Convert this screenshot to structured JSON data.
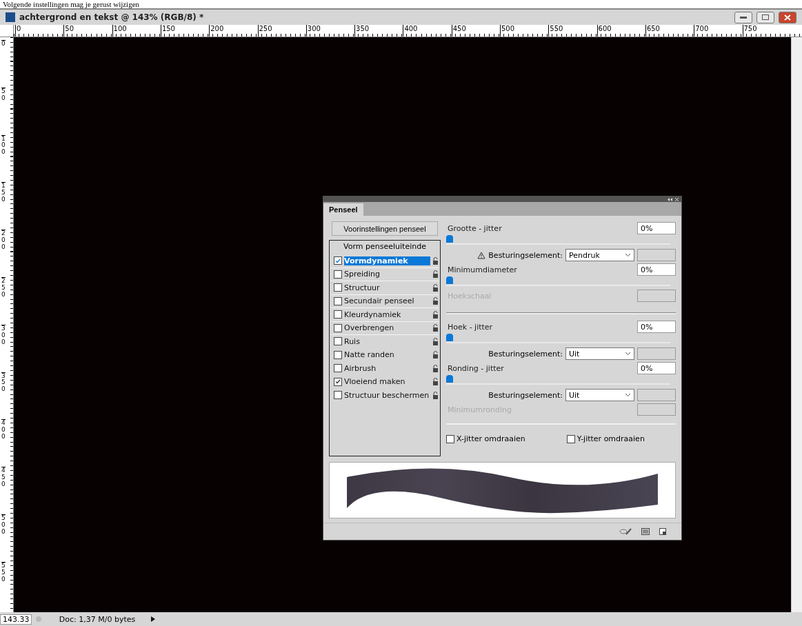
{
  "caption": "Volgende instellingen mag je gerust wijzigen",
  "window": {
    "title": "achtergrond en tekst @ 143% (RGB/8) *"
  },
  "ruler_h": [
    "0",
    "50",
    "100",
    "150",
    "200",
    "250",
    "300",
    "350",
    "400",
    "450",
    "500",
    "550",
    "600",
    "650",
    "700",
    "750"
  ],
  "ruler_v": [
    "0",
    "50",
    "100",
    "150",
    "200",
    "250",
    "300",
    "350",
    "400",
    "450",
    "500",
    "550"
  ],
  "panel": {
    "tab": {
      "label": "Penseel",
      "selected": true
    },
    "preset_button": "Voorinstellingen penseel",
    "options_header": "Vorm penseeluiteinde",
    "options": [
      {
        "label": "Vormdynamiek",
        "checked": true,
        "selected": true
      },
      {
        "label": "Spreiding",
        "checked": false,
        "selected": false
      },
      {
        "label": "Structuur",
        "checked": false,
        "selected": false
      },
      {
        "label": "Secundair penseel",
        "checked": false,
        "selected": false
      },
      {
        "label": "Kleurdynamiek",
        "checked": false,
        "selected": false
      },
      {
        "label": "Overbrengen",
        "checked": false,
        "selected": false
      },
      {
        "label": "Ruis",
        "checked": false,
        "selected": false
      },
      {
        "label": "Natte randen",
        "checked": false,
        "selected": false
      },
      {
        "label": "Airbrush",
        "checked": false,
        "selected": false
      },
      {
        "label": "Vloeiend maken",
        "checked": true,
        "selected": false
      },
      {
        "label": "Structuur beschermen",
        "checked": false,
        "selected": false
      }
    ],
    "settings": [
      {
        "kind": "slider",
        "label": "Grootte - jitter",
        "value": "0%",
        "level": 0
      },
      {
        "kind": "control",
        "label": "Besturingselement:",
        "value": "Pendruk",
        "warning": true
      },
      {
        "kind": "slider",
        "label": "Minimumdiameter",
        "value": "0%",
        "level": 0
      },
      {
        "kind": "disabled",
        "label": "Hoekschaal"
      },
      {
        "kind": "divider"
      },
      {
        "kind": "slider",
        "label": "Hoek - jitter",
        "value": "0%",
        "level": 0
      },
      {
        "kind": "control",
        "label": "Besturingselement:",
        "value": "Uit",
        "warning": false
      },
      {
        "kind": "slider",
        "label": "Ronding - jitter",
        "value": "0%",
        "level": 0
      },
      {
        "kind": "control",
        "label": "Besturingselement:",
        "value": "Uit",
        "warning": false
      },
      {
        "kind": "disabled",
        "label": "Minimumronding"
      }
    ],
    "flips": [
      {
        "label": "X-jitter omdraaien",
        "checked": false
      },
      {
        "label": "Y-jitter omdraaien",
        "checked": false
      }
    ]
  },
  "status_bar": {
    "zoom": "143.33",
    "doc": "Doc: 1,37 M/0 bytes"
  }
}
